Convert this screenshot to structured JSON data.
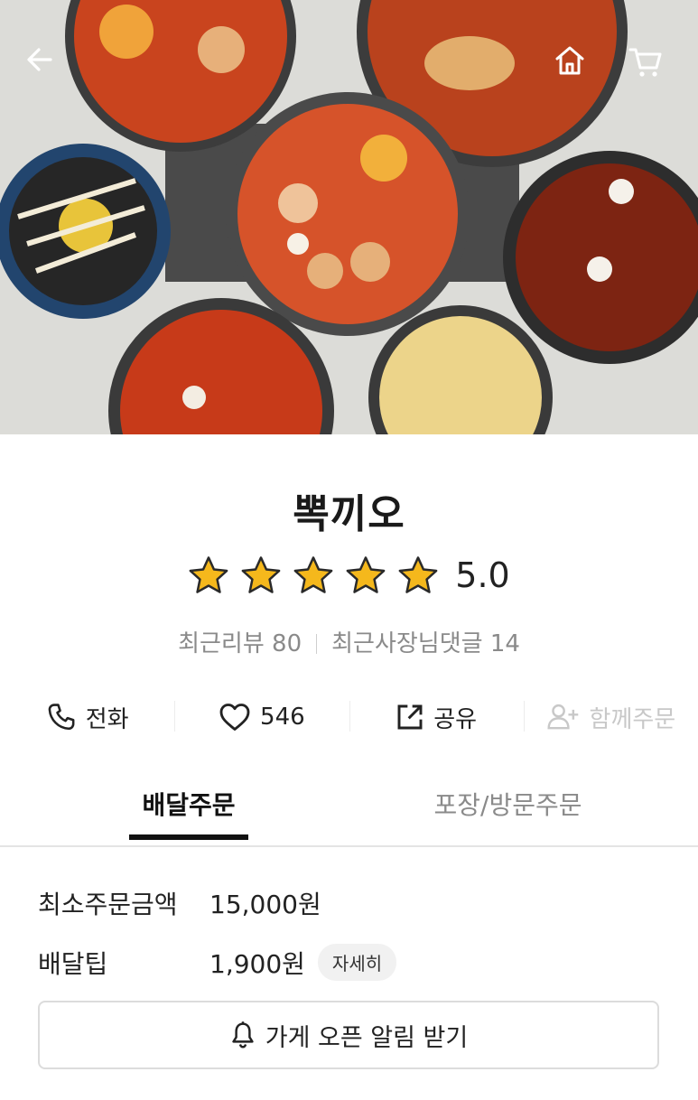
{
  "store": {
    "name": "뽁끼오",
    "rating": "5.0",
    "stars_filled": 5,
    "recent_reviews": "최근리뷰 80",
    "owner_replies": "최근사장님댓글 14"
  },
  "actions": {
    "call": "전화",
    "likes": "546",
    "share": "공유",
    "group_order": "함께주문"
  },
  "tabs": {
    "delivery": "배달주문",
    "pickup": "포장/방문주문"
  },
  "delivery_info": {
    "min_order_label": "최소주문금액",
    "min_order_value": "15,000원",
    "tip_label": "배달팁",
    "tip_value": "1,900원",
    "detail_button": "자세히"
  },
  "notify_button": "가게 오픈 알림 받기",
  "icons": {
    "back": "back-arrow-icon",
    "home": "home-icon",
    "cart": "cart-icon",
    "phone": "phone-icon",
    "heart": "heart-icon",
    "share": "share-icon",
    "add_user": "add-user-icon",
    "bell": "bell-icon",
    "star": "star-icon"
  },
  "colors": {
    "star": "#f5b81c",
    "active_tab": "#111111",
    "muted": "#8a8a8a"
  }
}
